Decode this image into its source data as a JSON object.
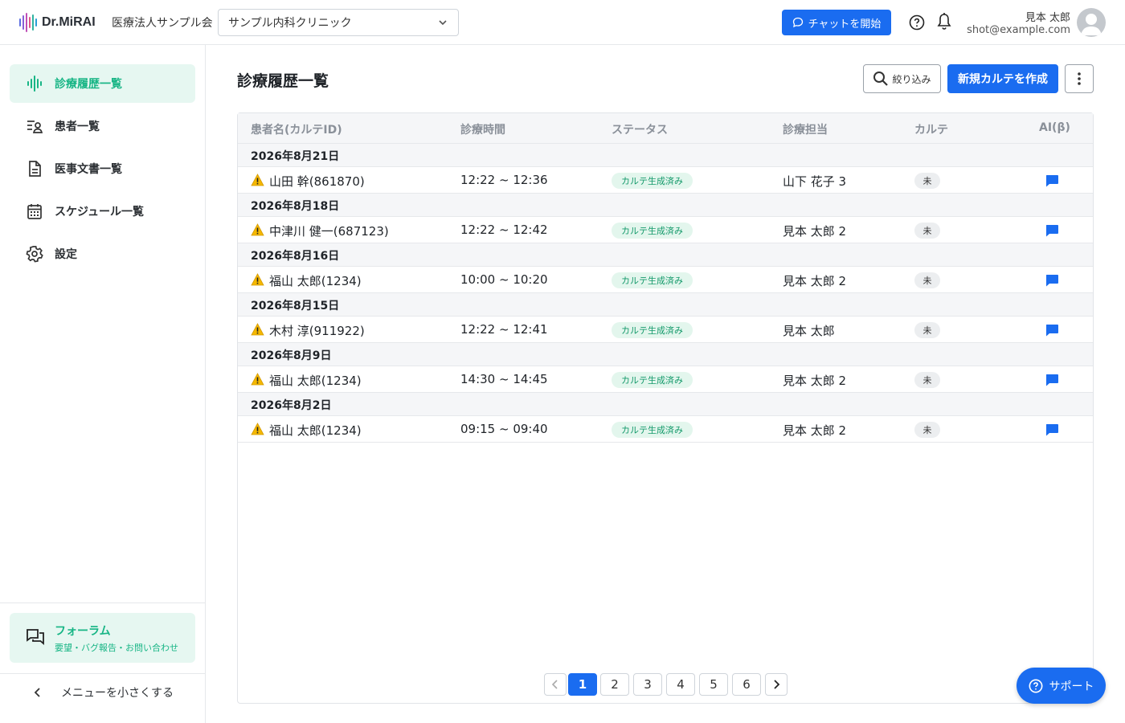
{
  "header": {
    "logo_text": "Dr.MiRAI",
    "org_name": "医療法人サンプル会",
    "clinic_select": "サンプル内科クリニック",
    "chat_button": "チャットを開始",
    "user_name": "見本 太郎",
    "user_email": "shot@example.com"
  },
  "sidebar": {
    "items": [
      {
        "label": "診療履歴一覧",
        "icon": "waveform-icon",
        "active": true
      },
      {
        "label": "患者一覧",
        "icon": "patient-list-icon",
        "active": false
      },
      {
        "label": "医事文書一覧",
        "icon": "document-icon",
        "active": false
      },
      {
        "label": "スケジュール一覧",
        "icon": "calendar-icon",
        "active": false
      },
      {
        "label": "設定",
        "icon": "gear-icon",
        "active": false
      }
    ],
    "forum_title": "フォーラム",
    "forum_sub": "要望・バグ報告・お問い合わせ",
    "collapse_label": "メニューを小さくする"
  },
  "main": {
    "title": "診療履歴一覧",
    "filter_button": "絞り込み",
    "new_button": "新規カルテを作成"
  },
  "table": {
    "columns": [
      "患者名(カルテID)",
      "診療時間",
      "ステータス",
      "診療担当",
      "カルテ",
      "AI(β)"
    ],
    "groups": [
      {
        "date": "2026年8月21日",
        "rows": [
          {
            "patient": "山田 幹(861870)",
            "time": "12:22 ~ 12:36",
            "status": "カルテ生成済み",
            "doctor": "山下 花子 3",
            "karte": "未"
          }
        ]
      },
      {
        "date": "2026年8月18日",
        "rows": [
          {
            "patient": "中津川 健一(687123)",
            "time": "12:22 ~ 12:42",
            "status": "カルテ生成済み",
            "doctor": "見本 太郎 2",
            "karte": "未"
          }
        ]
      },
      {
        "date": "2026年8月16日",
        "rows": [
          {
            "patient": "福山 太郎(1234)",
            "time": "10:00 ~ 10:20",
            "status": "カルテ生成済み",
            "doctor": "見本 太郎 2",
            "karte": "未"
          }
        ]
      },
      {
        "date": "2026年8月15日",
        "rows": [
          {
            "patient": "木村 淳(911922)",
            "time": "12:22 ~ 12:41",
            "status": "カルテ生成済み",
            "doctor": "見本 太郎",
            "karte": "未"
          }
        ]
      },
      {
        "date": "2026年8月9日",
        "rows": [
          {
            "patient": "福山 太郎(1234)",
            "time": "14:30 ~ 14:45",
            "status": "カルテ生成済み",
            "doctor": "見本 太郎 2",
            "karte": "未"
          }
        ]
      },
      {
        "date": "2026年8月2日",
        "rows": [
          {
            "patient": "福山 太郎(1234)",
            "time": "09:15 ~ 09:40",
            "status": "カルテ生成済み",
            "doctor": "見本 太郎 2",
            "karte": "未"
          }
        ]
      }
    ]
  },
  "pagination": {
    "pages": [
      "1",
      "2",
      "3",
      "4",
      "5",
      "6"
    ],
    "current": "1"
  },
  "support_button": "サポート",
  "colors": {
    "accent": "#1a6cf0",
    "nav_active": "#17b585",
    "status_bg": "#e3f6ed"
  }
}
